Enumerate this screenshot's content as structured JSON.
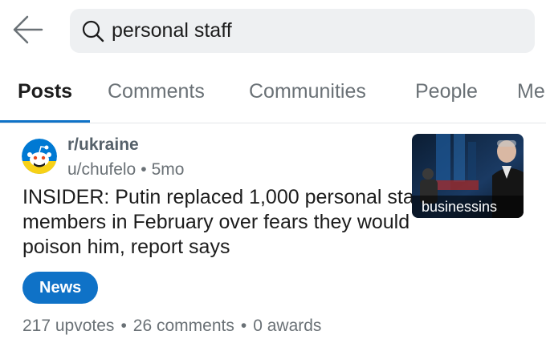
{
  "search": {
    "query": "personal staff"
  },
  "tabs": [
    {
      "label": "Posts",
      "active": true
    },
    {
      "label": "Comments",
      "active": false
    },
    {
      "label": "Communities",
      "active": false
    },
    {
      "label": "People",
      "active": false
    },
    {
      "label": "Me",
      "active": false
    }
  ],
  "post": {
    "community": "r/ukraine",
    "author": "u/chufelo",
    "age": "5mo",
    "separator": "•",
    "title": "INSIDER: Putin replaced 1,000 personal staff members in February over fears they would poison him, report says",
    "thumbnail_caption": "businessins",
    "flair": "News",
    "upvotes": "217 upvotes",
    "comments": "26 comments",
    "awards": "0 awards"
  },
  "colors": {
    "accent": "#0f72c7",
    "search_bg": "#eef0f2",
    "muted_text": "#6a7176"
  },
  "icons": {
    "back": "arrow-left-icon",
    "search": "search-icon",
    "avatar": "community-avatar-icon"
  }
}
